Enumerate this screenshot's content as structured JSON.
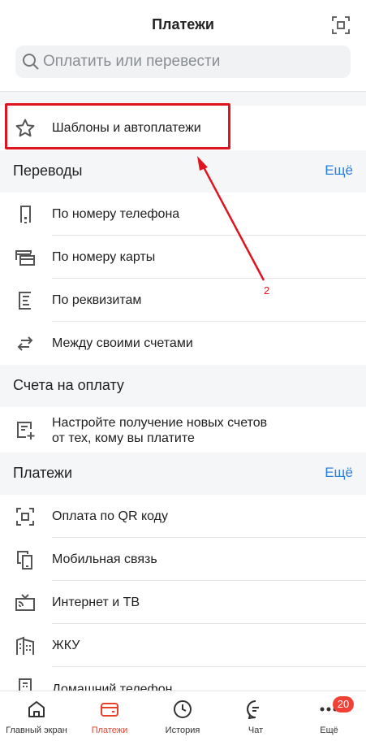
{
  "header": {
    "title": "Платежи",
    "scan_icon": "qr-scan-icon",
    "search": {
      "placeholder": "Оплатить или перевести",
      "icon": "search-icon"
    }
  },
  "templates": {
    "label": "Шаблоны и автоплатежи",
    "icon": "star-icon"
  },
  "transfers": {
    "title": "Переводы",
    "more": "Ещё",
    "items": [
      {
        "label": "По номеру телефона",
        "icon": "phone-icon"
      },
      {
        "label": "По номеру карты",
        "icon": "card-icon"
      },
      {
        "label": "По реквизитам",
        "icon": "document-icon"
      },
      {
        "label": "Между своими счетами",
        "icon": "swap-arrows-icon"
      }
    ]
  },
  "bills": {
    "title": "Счета на оплату",
    "item": {
      "line1": "Настройте получение новых счетов",
      "line2": "от тех, кому вы платите",
      "icon": "add-bill-icon"
    }
  },
  "payments": {
    "title": "Платежи",
    "more": "Ещё",
    "items": [
      {
        "label": "Оплата по QR коду",
        "icon": "qr-icon"
      },
      {
        "label": "Мобильная связь",
        "icon": "mobile-icon"
      },
      {
        "label": "Интернет и ТВ",
        "icon": "tv-icon"
      },
      {
        "label": "ЖКУ",
        "icon": "building-icon"
      },
      {
        "label": "Домашний телефон",
        "icon": "home-phone-icon"
      }
    ]
  },
  "annotation": {
    "number": "2"
  },
  "tabbar": {
    "tabs": [
      {
        "label": "Главный экран",
        "icon": "home-icon"
      },
      {
        "label": "Платежи",
        "icon": "wallet-icon",
        "active": true
      },
      {
        "label": "История",
        "icon": "clock-icon"
      },
      {
        "label": "Чат",
        "icon": "chat-icon"
      },
      {
        "label": "Ещё",
        "icon": "more-icon",
        "badge": "20"
      }
    ]
  },
  "colors": {
    "accent": "#2b7fe0",
    "active_tab": "#e8402c",
    "highlight": "#e0141e",
    "badge": "#f04134"
  }
}
